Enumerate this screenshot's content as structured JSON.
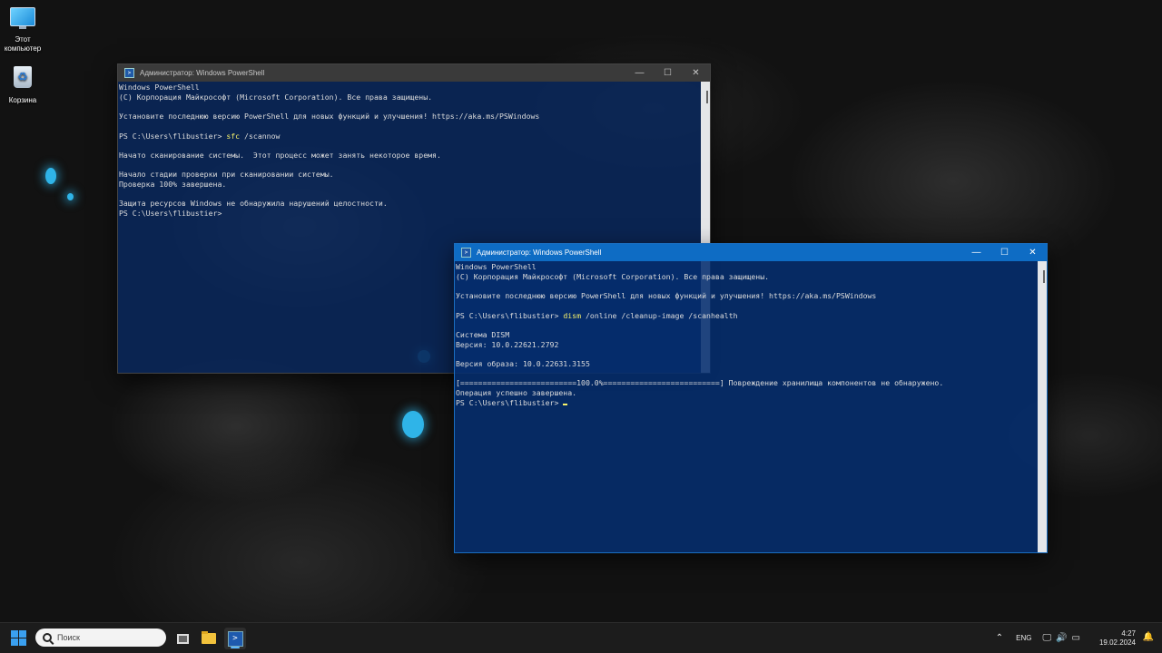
{
  "desktop": {
    "icons": [
      {
        "label_line1": "Этот",
        "label_line2": "компьютер",
        "icon": "computer-icon"
      },
      {
        "label_line1": "Корзина",
        "label_line2": "",
        "icon": "recycle-bin-icon"
      }
    ]
  },
  "window_back": {
    "title": "Администратор: Windows PowerShell",
    "lines": [
      "Windows PowerShell",
      "(C) Корпорация Майкрософт (Microsoft Corporation). Все права защищены.",
      "",
      "Установите последнюю версию PowerShell для новых функций и улучшения! https://aka.ms/PSWindows",
      "",
      "PS C:\\Users\\flibustier> "
    ],
    "command_word": "sfc",
    "command_rest": " /scannow",
    "lines_after": [
      "",
      "Начато сканирование системы.  Этот процесс может занять некоторое время.",
      "",
      "Начало стадии проверки при сканировании системы.",
      "Проверка 100% завершена.",
      "",
      "Защита ресурсов Windows не обнаружила нарушений целостности.",
      "PS C:\\Users\\flibustier>"
    ]
  },
  "window_front": {
    "title": "Администратор: Windows PowerShell",
    "lines": [
      "Windows PowerShell",
      "(C) Корпорация Майкрософт (Microsoft Corporation). Все права защищены.",
      "",
      "Установите последнюю версию PowerShell для новых функций и улучшения! https://aka.ms/PSWindows",
      "",
      "PS C:\\Users\\flibustier> "
    ],
    "command_word": "dism",
    "command_rest": " /online /cleanup-image /scanhealth",
    "lines_after": [
      "",
      "Система DISM",
      "Версия: 10.0.22621.2792",
      "",
      "Версия образа: 10.0.22631.3155",
      "",
      "[==========================100.0%==========================] Повреждение хранилища компонентов не обнаружено.",
      "Операция успешно завершена."
    ],
    "prompt": "PS C:\\Users\\flibustier> "
  },
  "taskbar": {
    "search_placeholder": "Поиск",
    "language": "ENG",
    "time": "4:27",
    "date": "19.02.2024",
    "tray_icons": [
      "chevron-up-icon",
      "network-icon",
      "volume-icon",
      "battery-icon"
    ]
  },
  "colors": {
    "console_bg": "#052d6e",
    "command_yellow": "#f7f26b",
    "active_title": "#0e6cc4",
    "accent": "#3aa0f0"
  }
}
